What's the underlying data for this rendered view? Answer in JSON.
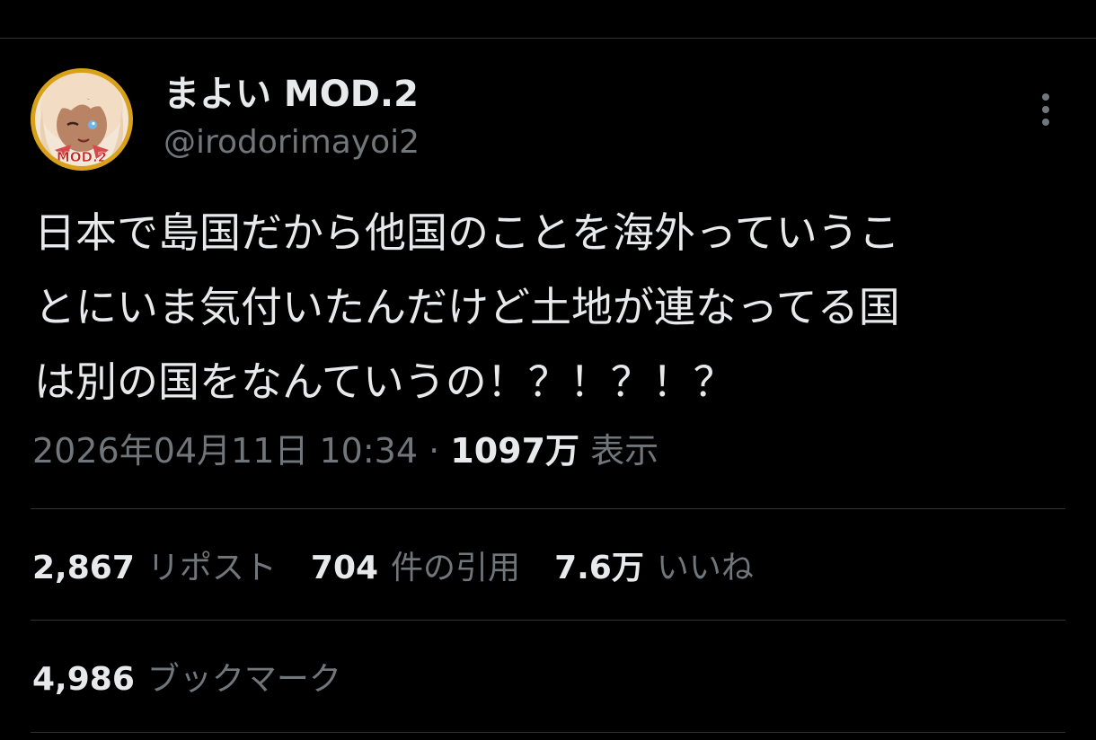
{
  "author": {
    "display_name": "まよい MOD.2",
    "handle": "@irodorimayoi2",
    "avatar_badge": "MOD.2"
  },
  "tweet": {
    "text": "日本で島国だから他国のことを海外っていうこ\nとにいま気付いたんだけど土地が連なってる国\nは別の国をなんていうの！？！？！？",
    "timestamp": "2026年04月11日 10:34",
    "separator": "·",
    "views_count": "1097万",
    "views_label": "表示"
  },
  "stats": {
    "reposts": {
      "count": "2,867",
      "label": "リポスト"
    },
    "quotes": {
      "count": "704",
      "label": "件の引用"
    },
    "likes": {
      "count": "7.6万",
      "label": "いいね"
    },
    "bookmarks": {
      "count": "4,986",
      "label": "ブックマーク"
    }
  },
  "icons": {
    "more": "more-vertical-icon"
  },
  "colors": {
    "background": "#000000",
    "primary_text": "#e7e9ea",
    "secondary_text": "#71767b",
    "divider": "#2f3336",
    "avatar_ring": "#d9a11a"
  }
}
